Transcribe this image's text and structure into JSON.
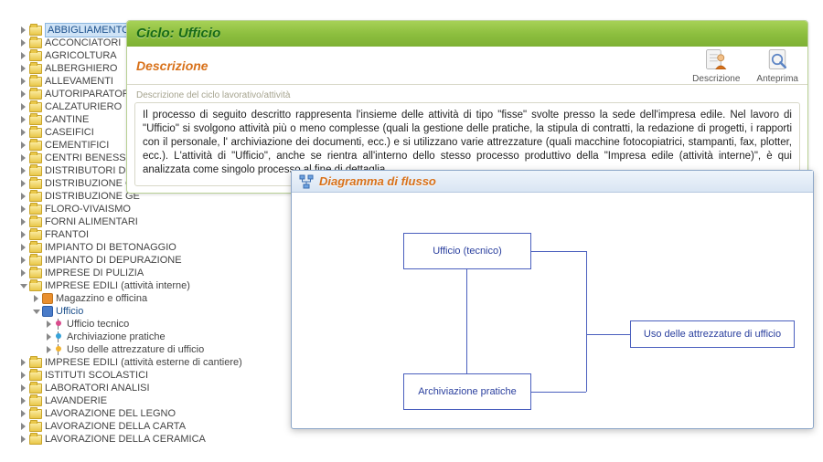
{
  "panel": {
    "title": "Ciclo: Ufficio",
    "subtitle": "Descrizione",
    "fieldset_label": "Descrizione del ciclo lavorativo/attività",
    "body": "Il processo di seguito descritto rappresenta l'insieme delle attività di tipo \"fisse\" svolte presso la sede dell'impresa edile. Nel lavoro di \"Ufficio\" si svolgono attività più o meno complesse (quali la gestione delle pratiche, la stipula di contratti, la redazione di progetti, i rapporti con il personale, l' archiviazione dei documenti, ecc.) e si utilizzano varie attrezzature (quali macchine fotocopiatrici, stampanti, fax, plotter, ecc.). L'attività di \"Ufficio\", anche se rientra all'interno dello stesso processo produttivo della \"Impresa edile (attività interne)\", è qui analizzata come singolo processo al fine di dettaglia",
    "actions": {
      "descrizione": "Descrizione",
      "anteprima": "Anteprima"
    }
  },
  "diagram": {
    "title": "Diagramma di flusso",
    "boxes": {
      "top": "Ufficio (tecnico)",
      "bottom": "Archiviazione pratiche",
      "right": "Uso delle attrezzature di ufficio"
    }
  },
  "tree": {
    "items": [
      {
        "label": "ABBIGLIAMENTO",
        "icon": "folder",
        "sel": true
      },
      {
        "label": "ACCONCIATORI",
        "icon": "folder"
      },
      {
        "label": "AGRICOLTURA",
        "icon": "folder"
      },
      {
        "label": "ALBERGHIERO",
        "icon": "folder"
      },
      {
        "label": "ALLEVAMENTI",
        "icon": "folder"
      },
      {
        "label": "AUTORIPARATORI",
        "icon": "folder"
      },
      {
        "label": "CALZATURIERO",
        "icon": "folder"
      },
      {
        "label": "CANTINE",
        "icon": "folder"
      },
      {
        "label": "CASEIFICI",
        "icon": "folder"
      },
      {
        "label": "CEMENTIFICI",
        "icon": "folder"
      },
      {
        "label": "CENTRI BENESSERE",
        "icon": "folder"
      },
      {
        "label": "DISTRIBUTORI DI B",
        "icon": "folder"
      },
      {
        "label": "DISTRIBUZIONE GE",
        "icon": "folder"
      },
      {
        "label": "DISTRIBUZIONE GE",
        "icon": "folder"
      },
      {
        "label": "FLORO-VIVAISMO",
        "icon": "folder"
      },
      {
        "label": "FORNI ALIMENTARI",
        "icon": "folder"
      },
      {
        "label": "FRANTOI",
        "icon": "folder"
      },
      {
        "label": "IMPIANTO DI BETONAGGIO",
        "icon": "folder"
      },
      {
        "label": "IMPIANTO DI DEPURAZIONE",
        "icon": "folder"
      },
      {
        "label": "IMPRESE DI PULIZIA",
        "icon": "folder"
      },
      {
        "label": "IMPRESE EDILI (attività interne)",
        "icon": "folder",
        "open": true,
        "children": [
          {
            "label": "Magazzino e officina",
            "icon": "sub-orange"
          },
          {
            "label": "Ufficio",
            "icon": "sub",
            "open": true,
            "active": true,
            "children": [
              {
                "label": "Ufficio tecnico",
                "icon": "leaf1"
              },
              {
                "label": "Archiviazione pratiche",
                "icon": "leaf2"
              },
              {
                "label": "Uso delle attrezzature di ufficio",
                "icon": "leaf3"
              }
            ]
          }
        ]
      },
      {
        "label": "IMPRESE EDILI (attività esterne di cantiere)",
        "icon": "folder"
      },
      {
        "label": "ISTITUTI SCOLASTICI",
        "icon": "folder"
      },
      {
        "label": "LABORATORI ANALISI",
        "icon": "folder"
      },
      {
        "label": "LAVANDERIE",
        "icon": "folder"
      },
      {
        "label": "LAVORAZIONE DEL LEGNO",
        "icon": "folder"
      },
      {
        "label": "LAVORAZIONE DELLA CARTA",
        "icon": "folder"
      },
      {
        "label": "LAVORAZIONE DELLA CERAMICA",
        "icon": "folder"
      }
    ]
  }
}
